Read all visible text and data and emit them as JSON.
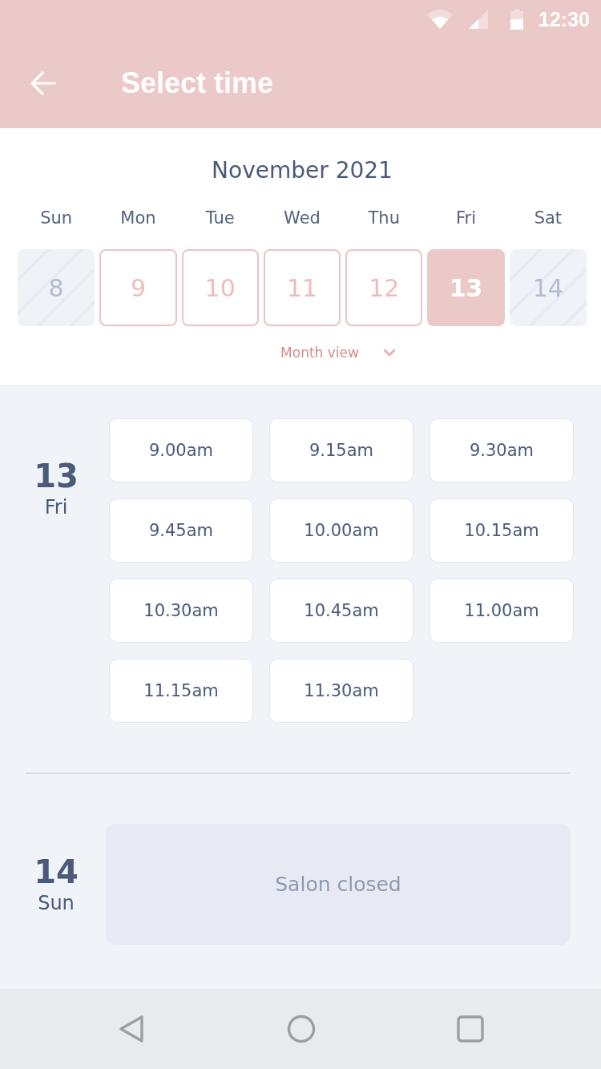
{
  "status_bar": {
    "time": "12:30"
  },
  "header": {
    "title": "Select time"
  },
  "calendar": {
    "month": "November 2021",
    "weekdays": [
      "Sun",
      "Mon",
      "Tue",
      "Wed",
      "Thu",
      "Fri",
      "Sat"
    ],
    "days": [
      {
        "label": "8",
        "disabled": true,
        "selected": false
      },
      {
        "label": "9",
        "disabled": false,
        "selected": false
      },
      {
        "label": "10",
        "disabled": false,
        "selected": false
      },
      {
        "label": "11",
        "disabled": false,
        "selected": false
      },
      {
        "label": "12",
        "disabled": false,
        "selected": false
      },
      {
        "label": "13",
        "disabled": false,
        "selected": true
      },
      {
        "label": "14",
        "disabled": true,
        "selected": false
      }
    ],
    "month_view": {
      "label": "Month view",
      "expanded": false
    }
  },
  "schedule": [
    {
      "kind": "slots",
      "date": "13",
      "weekday": "Fri",
      "slots": [
        "9.00am",
        "9.15am",
        "9.30am",
        "9.45am",
        "10.00am",
        "10.15am",
        "10.30am",
        "10.45am",
        "11.00am",
        "11.15am",
        "11.30am"
      ]
    },
    {
      "kind": "closed",
      "date": "14",
      "weekday": "Sun",
      "message": "Salon closed"
    }
  ]
}
